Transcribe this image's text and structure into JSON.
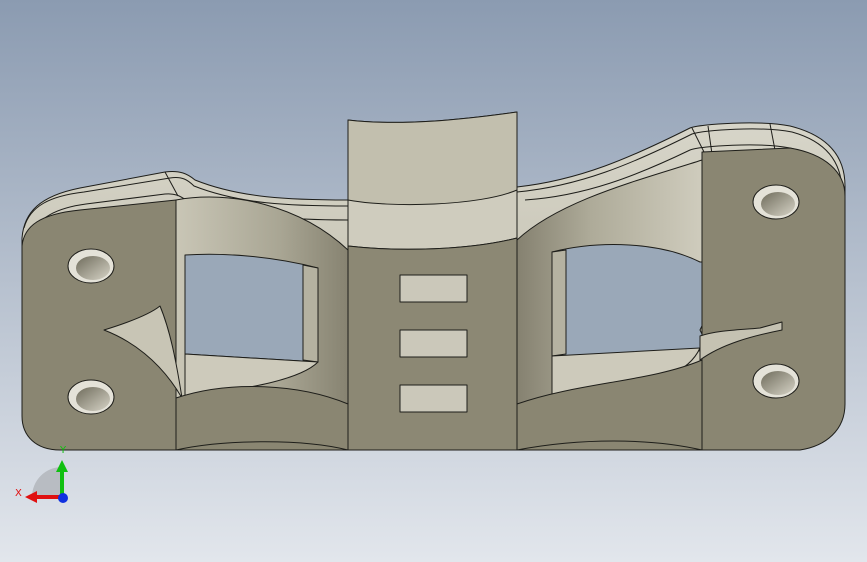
{
  "viewport": {
    "background_top": "#8b9bb1",
    "background_bottom": "#e2e6ec",
    "part_face": "#8c8874",
    "part_face_dark": "#6e6b5a",
    "part_top": "#c6c3b3",
    "part_top_light": "#d4d2c6",
    "slot_color": "#cbc8ba"
  },
  "triad": {
    "x_label": "X",
    "y_label": "Y",
    "x_color": "#e01010",
    "y_color": "#10c010",
    "z_color": "#1030e0"
  }
}
